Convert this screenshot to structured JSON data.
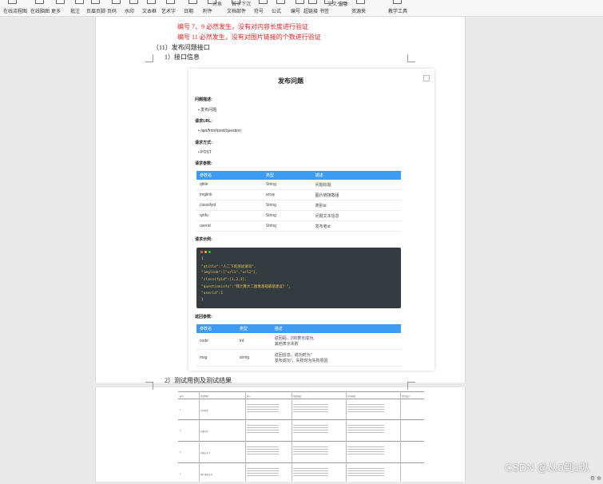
{
  "toolbar": {
    "items": [
      {
        "label": "在线流程图",
        "icon": "flowchart-icon"
      },
      {
        "label": "在线脑图",
        "icon": "mindmap-icon"
      },
      {
        "label": "更多",
        "icon": "more-icon"
      },
      {
        "label": "批注",
        "icon": "comment-icon"
      },
      {
        "label": "页眉页脚",
        "icon": "header-footer-icon"
      },
      {
        "label": "页码",
        "icon": "page-number-icon"
      },
      {
        "label": "水印",
        "icon": "watermark-icon"
      },
      {
        "label": "文本框",
        "icon": "textbox-icon"
      },
      {
        "label": "艺术字",
        "icon": "wordart-icon"
      },
      {
        "label": "日期",
        "icon": "date-icon"
      },
      {
        "label": "附件",
        "icon": "attachment-icon"
      },
      {
        "label": "文档部件",
        "icon": "doc-part-icon"
      },
      {
        "label": "符号",
        "icon": "symbol-icon"
      },
      {
        "label": "公式",
        "icon": "formula-icon"
      },
      {
        "label": "编号",
        "icon": "numbering-icon"
      },
      {
        "label": "超链接",
        "icon": "hyperlink-icon"
      },
      {
        "label": "书签",
        "icon": "bookmark-icon"
      },
      {
        "label": "资源夹",
        "icon": "resource-icon"
      },
      {
        "label": "教学工具",
        "icon": "teaching-icon"
      }
    ],
    "sub_labels": [
      "对象",
      "首字下沉",
      "交叉引用",
      "窗体"
    ]
  },
  "document": {
    "red_lines": [
      "编号 7、9 必然发生，没有对内容长度进行验证",
      "编号 11 必然发生，没有对图片链接的个数进行验证"
    ],
    "heading": "（11）发布问题接口",
    "subheading1": "1）接口信息",
    "subheading2": "2）测试用例及测试结果"
  },
  "api_doc": {
    "title": "发布问题",
    "description_label": "问题描述:",
    "description": "发布问题",
    "url_label": "请求URL:",
    "url": "/api/front/post/question",
    "method_label": "请求方式:",
    "method": "POST",
    "params_label": "请求参数:",
    "table_headers": [
      "参数名",
      "类型",
      "描述"
    ],
    "params": [
      [
        "qtitle",
        "String",
        "问题标题"
      ],
      [
        "imglink",
        "array",
        "图片链接数组"
      ],
      [
        "classifyid",
        "String",
        "类别id"
      ],
      [
        "qinfo",
        "String",
        "问题文本信息"
      ],
      [
        "userid",
        "String",
        "发布者id"
      ]
    ],
    "example_label": "请求示例:",
    "code_lines": [
      "{",
      "    \"qtitle\":\"人二下的测试请问\",",
      "    \"imglink\":[\"url1\",\"url2\"],",
      "    \"classifyid\":[1,2,3],",
      "    \"questioninfo\":\"我计算大二图像基础最基建议？\",",
      "    \"userid\":1",
      "}"
    ],
    "return_label": "返回参数:",
    "return_headers": [
      "参数名",
      "类型",
      "描述"
    ],
    "returns": [
      {
        "name": "code",
        "type": "int",
        "desc": [
          "返回码，200表示成功,",
          "其他表示失败"
        ]
      },
      {
        "name": "msg",
        "type": "string",
        "desc": [
          "返回信息，成功时为\"",
          "发布成功\"，失败时为失败原因"
        ]
      }
    ]
  },
  "mini_table": {
    "headers": [
      "编号",
      "测试用例",
      "输入",
      "期望结果",
      "实际结果",
      "是否通过"
    ],
    "rows": [
      "1",
      "2",
      "3",
      "4"
    ],
    "case_labels": [
      "正常发布",
      "标题为空",
      "标题过长 9",
      "图片链接过多"
    ]
  },
  "watermark": "CSDN @从0到1队",
  "colors": {
    "accent": "#3d9bf0",
    "red_text": "#e02020",
    "code_bg": "#343c40",
    "code_string": "#e6c35c",
    "code_text": "#d6d6d6"
  }
}
